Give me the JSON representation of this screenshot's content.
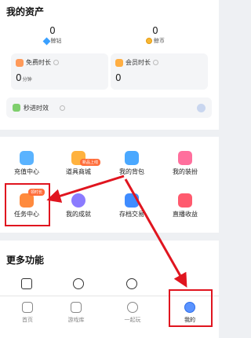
{
  "assets": {
    "title": "我的资产",
    "diamond": {
      "value": "0",
      "label": "鲸钻",
      "icon": "diamond-icon"
    },
    "coin": {
      "value": "0",
      "label": "鲸币",
      "icon": "coin-icon"
    },
    "free_time": {
      "label": "免费时长",
      "value": "0",
      "unit": "分钟"
    },
    "member_time": {
      "label": "会员时长",
      "value": "0"
    },
    "instant": {
      "label": "秒进时效"
    }
  },
  "grid": {
    "items": [
      {
        "label": "充值中心",
        "color": "#5ab3ff"
      },
      {
        "label": "道具商城",
        "color": "#ffb23e",
        "badge": "新品上线"
      },
      {
        "label": "我的背包",
        "color": "#4aa8ff"
      },
      {
        "label": "我的装扮",
        "color": "#ff6f9d"
      },
      {
        "label": "任务中心",
        "color": "#ff8a3d",
        "badge": "领时长"
      },
      {
        "label": "我的成就",
        "color": "#8b7bff"
      },
      {
        "label": "存档交易",
        "color": "#3f8cff"
      },
      {
        "label": "直播收益",
        "color": "#ff5a6e"
      }
    ]
  },
  "more": {
    "title": "更多功能"
  },
  "nav": {
    "items": [
      {
        "label": "首页"
      },
      {
        "label": "游戏库"
      },
      {
        "label": "一起玩"
      },
      {
        "label": "我的"
      }
    ]
  },
  "colors": {
    "annotation": "#e0151f",
    "accent": "#2f6fea"
  }
}
